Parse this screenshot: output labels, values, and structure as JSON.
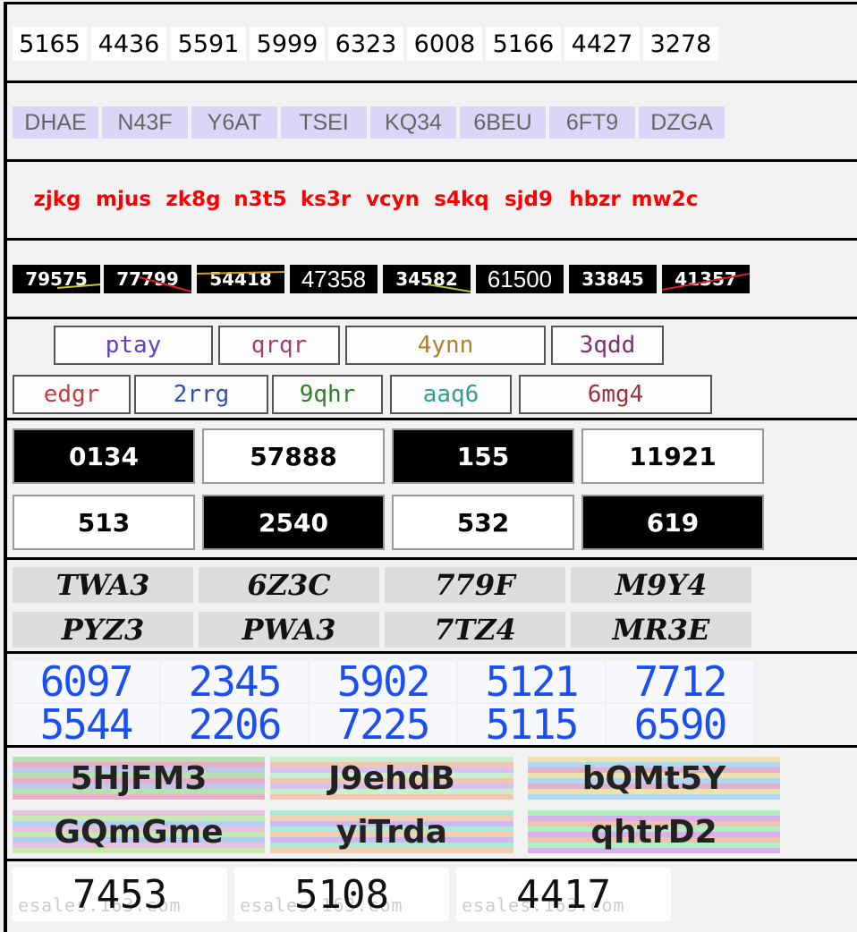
{
  "rows": [
    {
      "id": "row1",
      "captchas": [
        "5165",
        "4436",
        "5591",
        "5999",
        "6323",
        "6008",
        "5166",
        "4427",
        "3278"
      ]
    },
    {
      "id": "row2",
      "captchas": [
        "DHAE",
        "N43F",
        "Y6AT",
        "TSEI",
        "KQ34",
        "6BEU",
        "6FT9",
        "DZGA"
      ]
    },
    {
      "id": "row3",
      "captchas": [
        "zjkg",
        "mjus",
        "zk8g",
        "n3t5",
        "ks3r",
        "vcyn",
        "s4kq",
        "sjd9",
        "hbzr",
        "mw2c"
      ]
    },
    {
      "id": "row4",
      "captchas": [
        "79575",
        "77799",
        "54418",
        "47358",
        "34582",
        "61500",
        "33845",
        "41357"
      ]
    },
    {
      "id": "row5",
      "captchas": [
        "ptay",
        "qrqr",
        "4ynn",
        "3qdd",
        "edgr",
        "2rrg",
        "9qhr",
        "aaq6",
        "6mg4"
      ]
    },
    {
      "id": "row6",
      "captchas": [
        "0134",
        "57888",
        "155",
        "11921",
        "513",
        "2540",
        "532",
        "619"
      ]
    },
    {
      "id": "row7",
      "captchas": [
        "TWA3",
        "6Z3C",
        "779F",
        "M9Y4",
        "PYZ3",
        "PWA3",
        "7TZ4",
        "MR3E"
      ]
    },
    {
      "id": "row8",
      "captchas": [
        "6097",
        "2345",
        "5902",
        "5121",
        "7712",
        "5544",
        "2206",
        "7225",
        "5115",
        "6590"
      ]
    },
    {
      "id": "row9",
      "captchas": [
        "5HjFM3",
        "J9ehdB",
        "bQMt5Y",
        "GQmGme",
        "yiTrda",
        "qhtrD2"
      ]
    },
    {
      "id": "row10",
      "captchas": [
        "7453",
        "5108",
        "4417"
      ],
      "watermark": "esales.163.com"
    }
  ],
  "colors": {
    "border": "#000000",
    "row2_bg": "#ddd5f7",
    "row3_text": "#ff0000",
    "row8_text": "#1a4ff0"
  }
}
